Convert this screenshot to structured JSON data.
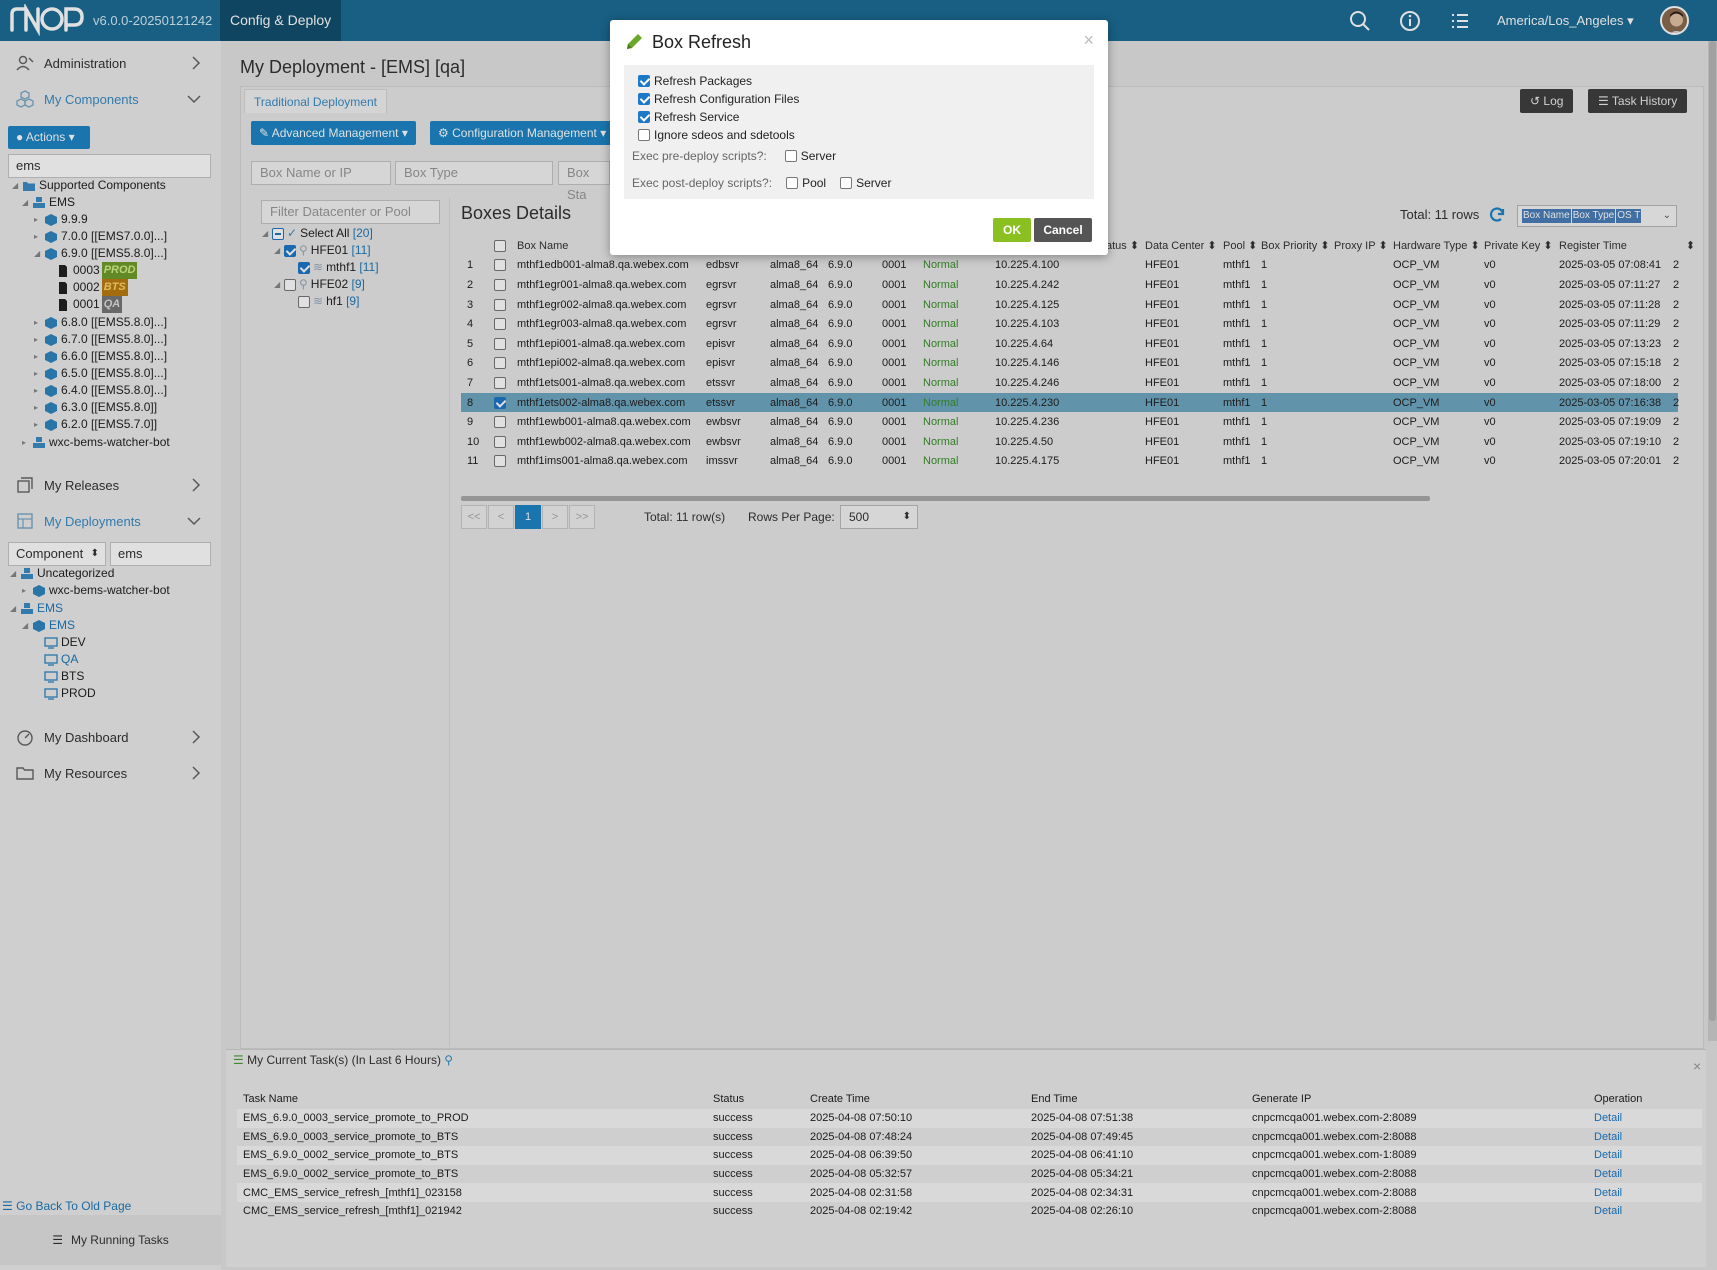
{
  "topbar": {
    "version": "v6.0.0-20250121242",
    "active_tab": "Config & Deploy",
    "timezone": "America/Los_Angeles",
    "icons": [
      "search-icon",
      "info-icon",
      "list-icon"
    ]
  },
  "sidebar": {
    "administration": "Administration",
    "my_components": "My Components",
    "actions": "Actions",
    "search_value": "ems",
    "tree": {
      "root": "Supported Components",
      "ems": "EMS",
      "items": [
        {
          "label": "9.9.9"
        },
        {
          "label": "7.0.0 [[EMS7.0.0]...]"
        },
        {
          "label": "6.9.0 [[EMS5.8.0]...]"
        },
        {
          "label": "6.8.0 [[EMS5.8.0]...]"
        },
        {
          "label": "6.7.0 [[EMS5.8.0]...]"
        },
        {
          "label": "6.6.0 [[EMS5.8.0]...]"
        },
        {
          "label": "6.5.0 [[EMS5.8.0]...]"
        },
        {
          "label": "6.4.0 [[EMS5.8.0]...]"
        },
        {
          "label": "6.3.0 [[EMS5.8.0]]"
        },
        {
          "label": "6.2.0 [[EMS5.7.0]]"
        }
      ],
      "sub": [
        {
          "id": "0003",
          "badge": "PROD"
        },
        {
          "id": "0002",
          "badge": "BTS"
        },
        {
          "id": "0001",
          "badge": "QA"
        }
      ],
      "bot": "wxc-bems-watcher-bot"
    },
    "my_releases": "My Releases",
    "my_deployments": "My Deployments",
    "dep_filter_type": "Component",
    "dep_filter_value": "ems",
    "dep_tree": {
      "uncategorized": "Uncategorized",
      "bot": "wxc-bems-watcher-bot",
      "ems": "EMS",
      "ems_sub": "EMS",
      "envs": [
        "DEV",
        "QA",
        "BTS",
        "PROD"
      ]
    },
    "my_dashboard": "My Dashboard",
    "my_resources": "My Resources",
    "go_back": "Go Back To Old Page",
    "running_tasks": "My Running Tasks"
  },
  "main": {
    "title": "My Deployment - [EMS] [qa]",
    "tab": "Traditional Deployment",
    "log": "Log",
    "task_history": "Task History",
    "advanced_mgmt": "Advanced Management",
    "config_mgmt": "Configuration Management",
    "filter_box_name": "Box Name or IP",
    "filter_box_type": "Box Type",
    "filter_box_status": "Box Sta",
    "filter_dc": "Filter Datacenter or Pool",
    "left_tree": {
      "select_all": "Select All",
      "select_all_count": "[20]",
      "hfe01": "HFE01",
      "hfe01_count": "[11]",
      "mthf1": "mthf1",
      "mthf1_count": "[11]",
      "hfe02": "HFE02",
      "hfe02_count": "[9]",
      "hf1": "hf1",
      "hf1_count": "[9]"
    },
    "boxes_title": "Boxes Details",
    "total_rows": "Total: 11 rows",
    "column_chips": [
      "Box Name",
      "Box Type",
      "OS T"
    ],
    "columns": [
      "Box Name",
      "atus",
      "Data Center",
      "Pool",
      "Box Priority",
      "Proxy IP",
      "Hardware Type",
      "Private Key",
      "Register Time"
    ],
    "rows": [
      {
        "n": "1",
        "name": "mthf1edb001-alma8.qa.webex.com",
        "type": "edbsvr",
        "os": "alma8_64",
        "ver": "6.9.0",
        "bn": "0001",
        "status": "Normal",
        "ip": "10.225.4.100",
        "dc": "HFE01",
        "pool": "mthf1",
        "prio": "1",
        "hw": "OCP_VM",
        "key": "v0",
        "time": "2025-03-05 07:08:41",
        "x": "2"
      },
      {
        "n": "2",
        "name": "mthf1egr001-alma8.qa.webex.com",
        "type": "egrsvr",
        "os": "alma8_64",
        "ver": "6.9.0",
        "bn": "0001",
        "status": "Normal",
        "ip": "10.225.4.242",
        "dc": "HFE01",
        "pool": "mthf1",
        "prio": "1",
        "hw": "OCP_VM",
        "key": "v0",
        "time": "2025-03-05 07:11:27",
        "x": "2"
      },
      {
        "n": "3",
        "name": "mthf1egr002-alma8.qa.webex.com",
        "type": "egrsvr",
        "os": "alma8_64",
        "ver": "6.9.0",
        "bn": "0001",
        "status": "Normal",
        "ip": "10.225.4.125",
        "dc": "HFE01",
        "pool": "mthf1",
        "prio": "1",
        "hw": "OCP_VM",
        "key": "v0",
        "time": "2025-03-05 07:11:28",
        "x": "2"
      },
      {
        "n": "4",
        "name": "mthf1egr003-alma8.qa.webex.com",
        "type": "egrsvr",
        "os": "alma8_64",
        "ver": "6.9.0",
        "bn": "0001",
        "status": "Normal",
        "ip": "10.225.4.103",
        "dc": "HFE01",
        "pool": "mthf1",
        "prio": "1",
        "hw": "OCP_VM",
        "key": "v0",
        "time": "2025-03-05 07:11:29",
        "x": "2"
      },
      {
        "n": "5",
        "name": "mthf1epi001-alma8.qa.webex.com",
        "type": "episvr",
        "os": "alma8_64",
        "ver": "6.9.0",
        "bn": "0001",
        "status": "Normal",
        "ip": "10.225.4.64",
        "dc": "HFE01",
        "pool": "mthf1",
        "prio": "1",
        "hw": "OCP_VM",
        "key": "v0",
        "time": "2025-03-05 07:13:23",
        "x": "2"
      },
      {
        "n": "6",
        "name": "mthf1epi002-alma8.qa.webex.com",
        "type": "episvr",
        "os": "alma8_64",
        "ver": "6.9.0",
        "bn": "0001",
        "status": "Normal",
        "ip": "10.225.4.146",
        "dc": "HFE01",
        "pool": "mthf1",
        "prio": "1",
        "hw": "OCP_VM",
        "key": "v0",
        "time": "2025-03-05 07:15:18",
        "x": "2"
      },
      {
        "n": "7",
        "name": "mthf1ets001-alma8.qa.webex.com",
        "type": "etssvr",
        "os": "alma8_64",
        "ver": "6.9.0",
        "bn": "0001",
        "status": "Normal",
        "ip": "10.225.4.246",
        "dc": "HFE01",
        "pool": "mthf1",
        "prio": "1",
        "hw": "OCP_VM",
        "key": "v0",
        "time": "2025-03-05 07:18:00",
        "x": "2"
      },
      {
        "n": "8",
        "name": "mthf1ets002-alma8.qa.webex.com",
        "type": "etssvr",
        "os": "alma8_64",
        "ver": "6.9.0",
        "bn": "0001",
        "status": "Normal",
        "ip": "10.225.4.230",
        "dc": "HFE01",
        "pool": "mthf1",
        "prio": "1",
        "hw": "OCP_VM",
        "key": "v0",
        "time": "2025-03-05 07:16:38",
        "x": "2"
      },
      {
        "n": "9",
        "name": "mthf1ewb001-alma8.qa.webex.com",
        "type": "ewbsvr",
        "os": "alma8_64",
        "ver": "6.9.0",
        "bn": "0001",
        "status": "Normal",
        "ip": "10.225.4.236",
        "dc": "HFE01",
        "pool": "mthf1",
        "prio": "1",
        "hw": "OCP_VM",
        "key": "v0",
        "time": "2025-03-05 07:19:09",
        "x": "2"
      },
      {
        "n": "10",
        "name": "mthf1ewb002-alma8.qa.webex.com",
        "type": "ewbsvr",
        "os": "alma8_64",
        "ver": "6.9.0",
        "bn": "0001",
        "status": "Normal",
        "ip": "10.225.4.50",
        "dc": "HFE01",
        "pool": "mthf1",
        "prio": "1",
        "hw": "OCP_VM",
        "key": "v0",
        "time": "2025-03-05 07:19:10",
        "x": "2"
      },
      {
        "n": "11",
        "name": "mthf1ims001-alma8.qa.webex.com",
        "type": "imssvr",
        "os": "alma8_64",
        "ver": "6.9.0",
        "bn": "0001",
        "status": "Normal",
        "ip": "10.225.4.175",
        "dc": "HFE01",
        "pool": "mthf1",
        "prio": "1",
        "hw": "OCP_VM",
        "key": "v0",
        "time": "2025-03-05 07:20:01",
        "x": "2"
      }
    ],
    "pager": {
      "first": "<<",
      "prev": "<",
      "current": "1",
      "next": ">",
      "last": ">>",
      "total": "Total: 11 row(s)",
      "rows_per_page_label": "Rows Per Page:",
      "rows_per_page": "500"
    }
  },
  "tasks": {
    "title": "My Current Task(s) (In Last 6 Hours)",
    "columns": [
      "Task Name",
      "Status",
      "Create Time",
      "End Time",
      "Generate IP",
      "Operation"
    ],
    "rows": [
      {
        "name": "EMS_6.9.0_0003_service_promote_to_PROD",
        "status": "success",
        "create": "2025-04-08 07:50:10",
        "end": "2025-04-08 07:51:38",
        "ip": "cnpcmcqa001.webex.com-2:8089",
        "op": "Detail"
      },
      {
        "name": "EMS_6.9.0_0003_service_promote_to_BTS",
        "status": "success",
        "create": "2025-04-08 07:48:24",
        "end": "2025-04-08 07:49:45",
        "ip": "cnpcmcqa001.webex.com-2:8088",
        "op": "Detail"
      },
      {
        "name": "EMS_6.9.0_0002_service_promote_to_BTS",
        "status": "success",
        "create": "2025-04-08 06:39:50",
        "end": "2025-04-08 06:41:10",
        "ip": "cnpcmcqa001.webex.com-1:8089",
        "op": "Detail"
      },
      {
        "name": "EMS_6.9.0_0002_service_promote_to_BTS",
        "status": "success",
        "create": "2025-04-08 05:32:57",
        "end": "2025-04-08 05:34:21",
        "ip": "cnpcmcqa001.webex.com-2:8088",
        "op": "Detail"
      },
      {
        "name": "CMC_EMS_service_refresh_[mthf1]_023158",
        "status": "success",
        "create": "2025-04-08 02:31:58",
        "end": "2025-04-08 02:34:31",
        "ip": "cnpcmcqa001.webex.com-2:8088",
        "op": "Detail"
      },
      {
        "name": "CMC_EMS_service_refresh_[mthf1]_021942",
        "status": "success",
        "create": "2025-04-08 02:19:42",
        "end": "2025-04-08 02:26:10",
        "ip": "cnpcmcqa001.webex.com-2:8088",
        "op": "Detail"
      }
    ]
  },
  "modal": {
    "title": "Box Refresh",
    "refresh_packages": "Refresh Packages",
    "refresh_config": "Refresh Configuration Files",
    "refresh_service": "Refresh Service",
    "ignore_sdeos": "Ignore sdeos and sdetools",
    "pre_deploy_label": "Exec pre-deploy scripts?:",
    "post_deploy_label": "Exec post-deploy scripts?:",
    "server": "Server",
    "pool": "Pool",
    "ok": "OK",
    "cancel": "Cancel"
  },
  "colors": {
    "topbar": "#1c6d96",
    "accent": "#1e86c6",
    "ok": "#8ac121",
    "normal": "#3a8f2b"
  }
}
